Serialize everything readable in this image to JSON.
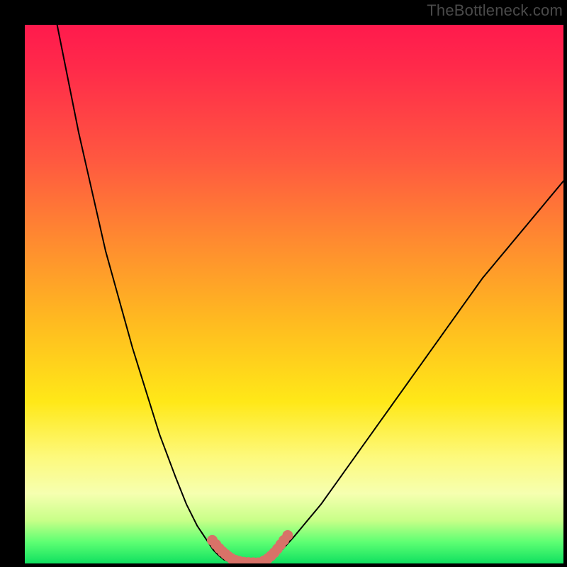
{
  "watermark": "TheBottleneck.com",
  "chart_data": {
    "type": "line",
    "title": "",
    "xlabel": "",
    "ylabel": "",
    "xlim": [
      0,
      100
    ],
    "ylim": [
      0,
      100
    ],
    "grid": false,
    "legend": false,
    "annotations": [],
    "series": [
      {
        "name": "left-descent",
        "color": "#000000",
        "x": [
          6,
          10,
          15,
          20,
          25,
          28,
          30,
          32,
          34,
          35,
          36,
          37,
          38
        ],
        "y": [
          100,
          80,
          58,
          40,
          24,
          16,
          11,
          7,
          4,
          2.5,
          1.5,
          0.7,
          0.3
        ]
      },
      {
        "name": "right-ascent",
        "color": "#000000",
        "x": [
          44,
          45,
          46,
          48,
          50,
          55,
          60,
          65,
          70,
          75,
          80,
          85,
          90,
          95,
          100
        ],
        "y": [
          0.3,
          0.7,
          1.3,
          2.8,
          5,
          11,
          18,
          25,
          32,
          39,
          46,
          53,
          59,
          65,
          71
        ]
      },
      {
        "name": "valley-floor",
        "color": "#000000",
        "x": [
          38,
          40,
          42,
          44
        ],
        "y": [
          0.3,
          0.1,
          0.1,
          0.3
        ]
      },
      {
        "name": "highlight-dots-left",
        "color": "#d87268",
        "x": [
          34.8,
          35.5,
          36.1,
          36.7,
          37.3,
          37.8,
          38.4,
          39.1,
          39.8,
          40.6,
          41.5,
          42.4,
          43.3
        ],
        "y": [
          4.3,
          3.5,
          2.8,
          2.2,
          1.7,
          1.3,
          0.9,
          0.6,
          0.4,
          0.25,
          0.18,
          0.14,
          0.13
        ]
      },
      {
        "name": "highlight-dots-right",
        "color": "#d87268",
        "x": [
          44.4,
          45.1,
          45.7,
          46.3,
          46.9,
          47.5,
          48.1,
          48.8
        ],
        "y": [
          0.5,
          0.9,
          1.4,
          2.0,
          2.7,
          3.5,
          4.3,
          5.2
        ]
      }
    ],
    "gradient_stops": [
      {
        "pos": 0,
        "color": "#ff1a4d"
      },
      {
        "pos": 25,
        "color": "#ff5840"
      },
      {
        "pos": 55,
        "color": "#ffba20"
      },
      {
        "pos": 80,
        "color": "#fdf97a"
      },
      {
        "pos": 92,
        "color": "#c8ff88"
      },
      {
        "pos": 100,
        "color": "#10e060"
      }
    ]
  }
}
